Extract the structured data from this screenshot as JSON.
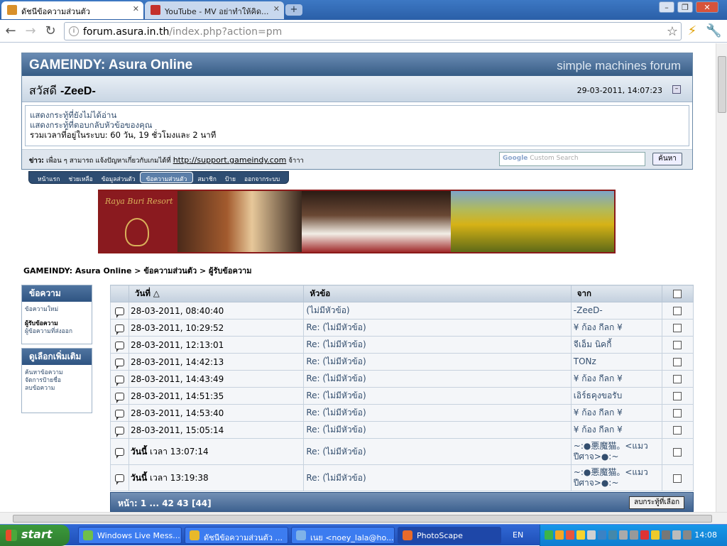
{
  "browser": {
    "tabs": [
      {
        "label": "ดัชนีข้อความส่วนตัว",
        "active": true
      },
      {
        "label": "YouTube - MV อย่าทำให้คิด...",
        "active": false
      }
    ],
    "url_host": "forum.asura.in.th",
    "url_path": "/index.php?action=pm"
  },
  "forum": {
    "title": "GAMEINDY: Asura Online",
    "smf_logo": "simple machines forum",
    "greeting_prefix": "สวัสดี",
    "username": "-ZeeD-",
    "datetime": "29-03-2011, 14:07:23",
    "links": [
      "แสดงกระทู้ที่ยังไม่ได้อ่าน",
      "แสดงกระทู้ที่ตอบกลับหัวข้อของคุณ"
    ],
    "online_time": "รวมเวลาที่อยู่ในระบบ: 60 วัน, 19 ชั่วโมงและ 2 นาที",
    "news_label": "ข่าว:",
    "news_text": "เพื่อน ๆ สามารถ แจ้งปัญหาเกี่ยวกับเกมได้ที่",
    "news_link": "http://support.gameindy.com",
    "news_suffix": "จ้าาา",
    "search_placeholder_brand": "Google",
    "search_placeholder": "Custom Search",
    "search_button": "ค้นหา"
  },
  "menu": [
    "หน้าแรก",
    "ช่วยเหลือ",
    "ข้อมูลส่วนตัว",
    "ข้อความส่วนตัว",
    "สมาชิก",
    "ป้าย",
    "ออกจากระบบ"
  ],
  "banner": {
    "logo_text": "Raya Buri Resort"
  },
  "breadcrumb": "GAMEINDY: Asura Online > ข้อความส่วนตัว > ผู้รับข้อความ",
  "sidebar": {
    "box1_title": "ข้อความ",
    "box1_items": [
      "ข้อความใหม่",
      "ผู้รับข้อความ",
      "ผู้ข้อความที่ส่งออก"
    ],
    "box2_title": "ดูเลือกเพิ่มเติม",
    "box2_items": [
      "ค้นหาข้อความ",
      "จัดการป้ายชื่อ",
      "ลบข้อความ"
    ]
  },
  "table": {
    "headers": [
      "วันที่ △",
      "หัวข้อ",
      "จาก"
    ],
    "rows": [
      {
        "date": "28-03-2011, 08:40:40",
        "subject": "(ไม่มีหัวข้อ)",
        "from": "-ZeeD-"
      },
      {
        "date": "28-03-2011, 10:29:52",
        "subject": "Re: (ไม่มีหัวข้อ)",
        "from": "¥ ก้อง กีลก ¥"
      },
      {
        "date": "28-03-2011, 12:13:01",
        "subject": "Re: (ไม่มีหัวข้อ)",
        "from": "จีเอ็ม นิคกี้"
      },
      {
        "date": "28-03-2011, 14:42:13",
        "subject": "Re: (ไม่มีหัวข้อ)",
        "from": "TONz"
      },
      {
        "date": "28-03-2011, 14:43:49",
        "subject": "Re: (ไม่มีหัวข้อ)",
        "from": "¥ ก้อง กีลก ¥"
      },
      {
        "date": "28-03-2011, 14:51:35",
        "subject": "Re: (ไม่มีหัวข้อ)",
        "from": "เอิร์ธคุงขอรับ"
      },
      {
        "date": "28-03-2011, 14:53:40",
        "subject": "Re: (ไม่มีหัวข้อ)",
        "from": "¥ ก้อง กีลก ¥"
      },
      {
        "date": "28-03-2011, 15:05:14",
        "subject": "Re: (ไม่มีหัวข้อ)",
        "from": "¥ ก้อง กีลก ¥"
      }
    ],
    "today_rows": [
      {
        "today": "วันนี้",
        "time": "เวลา 13:07:14",
        "subject": "Re: (ไม่มีหัวข้อ)",
        "from": "~:●悪魔猫。<แมวปีศาจ>●:~"
      },
      {
        "today": "วันนี้",
        "time": "เวลา 13:19:38",
        "subject": "Re: (ไม่มีหัวข้อ)",
        "from": "~:●悪魔猫。<แมวปีศาจ>●:~"
      }
    ],
    "pages": "หน้า: 1 ... 42 43 [44]",
    "delete_button": "ลบกระทู้ที่เลือก"
  },
  "taskbar": {
    "start": "start",
    "tasks": [
      "Windows Live Mess...",
      "ดัชนีข้อความส่วนตัว ...",
      "เนย <noey_lala@ho...",
      "PhotoScape"
    ],
    "lang": "EN",
    "clock": "14:08"
  }
}
